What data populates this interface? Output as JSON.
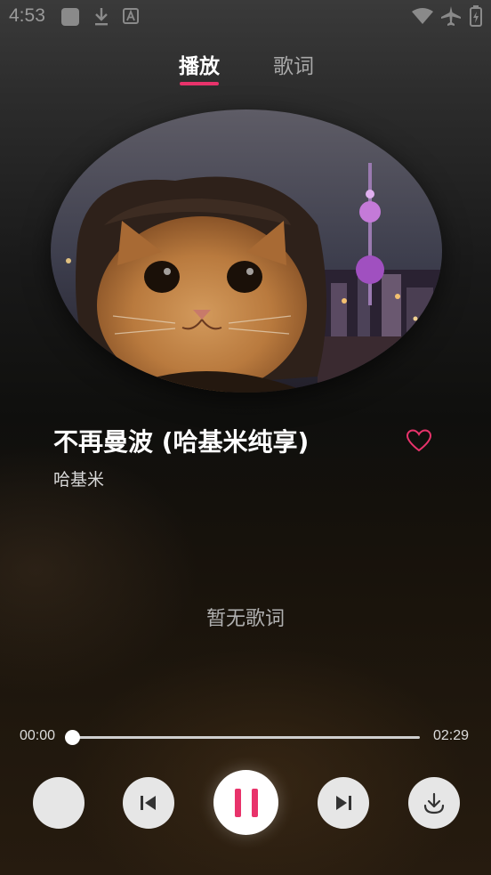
{
  "status_bar": {
    "time": "4:53",
    "left_icons": [
      "app-icon",
      "download-icon",
      "font-icon"
    ],
    "right_icons": [
      "wifi-icon",
      "airplane-icon",
      "battery-icon"
    ]
  },
  "tabs": [
    {
      "label": "播放",
      "active": true
    },
    {
      "label": "歌词",
      "active": false
    }
  ],
  "song": {
    "title": "不再曼波 (哈基米纯享)",
    "artist": "哈基米",
    "favorited": false
  },
  "lyrics": {
    "empty_text": "暂无歌词"
  },
  "progress": {
    "current": "00:00",
    "total": "02:29",
    "fraction": 0.0
  },
  "controls": {
    "mode_icon": "play-mode-icon",
    "prev_icon": "skip-previous-icon",
    "play_state": "playing",
    "next_icon": "skip-next-icon",
    "download_icon": "download-icon"
  },
  "colors": {
    "accent": "#e8336b",
    "text_primary": "#ffffff",
    "text_secondary": "#a8a8a8"
  }
}
